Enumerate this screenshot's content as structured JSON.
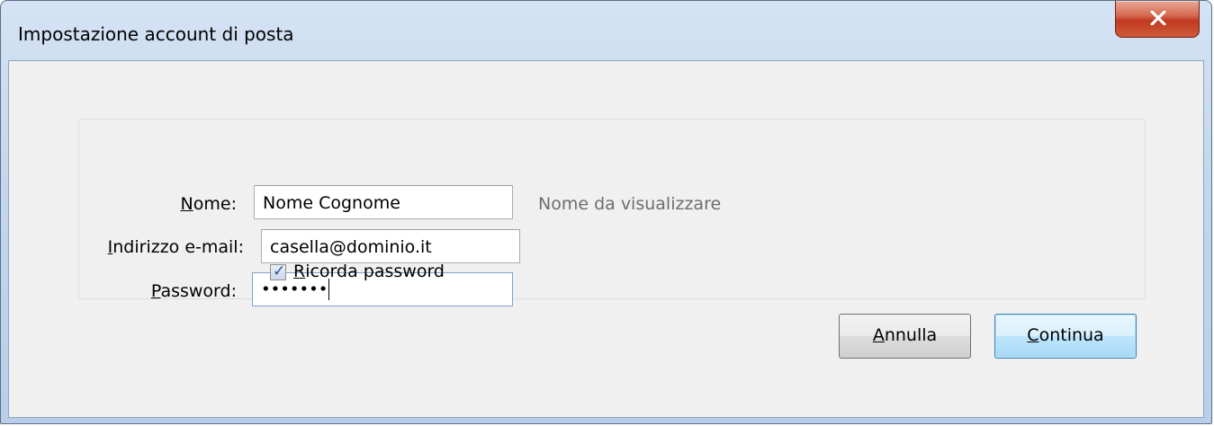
{
  "window": {
    "title": "Impostazione account di posta"
  },
  "form": {
    "name_label": "Nome:",
    "name_value": "Nome Cognome",
    "name_hint": "Nome da visualizzare",
    "email_label": "Indirizzo e-mail:",
    "email_value": "casella@dominio.it",
    "password_label": "Password:",
    "password_value": "•••••••",
    "remember_label": "Ricorda password",
    "remember_checked": true
  },
  "buttons": {
    "cancel_label": "Annulla",
    "continue_label": "Continua"
  },
  "icons": {
    "close": "close-icon",
    "checkmark": "checkmark-icon"
  }
}
